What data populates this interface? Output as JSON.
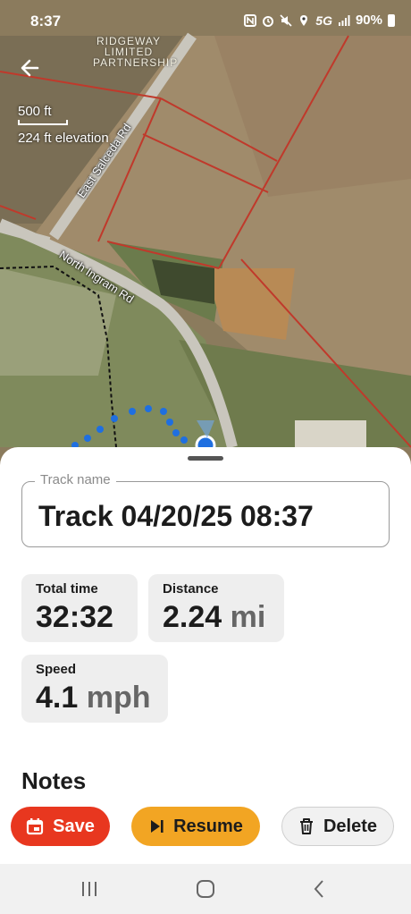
{
  "status_bar": {
    "time": "8:37",
    "network": "5G",
    "battery": "90%"
  },
  "map": {
    "parcel_owner": [
      "RIDGEWAY",
      "LIMITED",
      "PARTNERSHIP"
    ],
    "scale_distance": "500 ft",
    "elevation": "224 ft elevation",
    "roads": [
      "East Salceda Rd",
      "North Ingram Rd"
    ]
  },
  "track": {
    "field_label": "Track name",
    "name": "Track 04/20/25 08:37"
  },
  "stats": {
    "total_time": {
      "label": "Total time",
      "value": "32:32"
    },
    "distance": {
      "label": "Distance",
      "value": "2.24",
      "unit": "mi"
    },
    "speed": {
      "label": "Speed",
      "value": "4.1",
      "unit": "mph"
    }
  },
  "notes": {
    "title": "Notes"
  },
  "actions": {
    "save": "Save",
    "resume": "Resume",
    "delete": "Delete"
  },
  "colors": {
    "save": "#e8371f",
    "resume": "#f2a523",
    "track_line": "#1f6fe0",
    "parcel_line": "#c0392b"
  }
}
